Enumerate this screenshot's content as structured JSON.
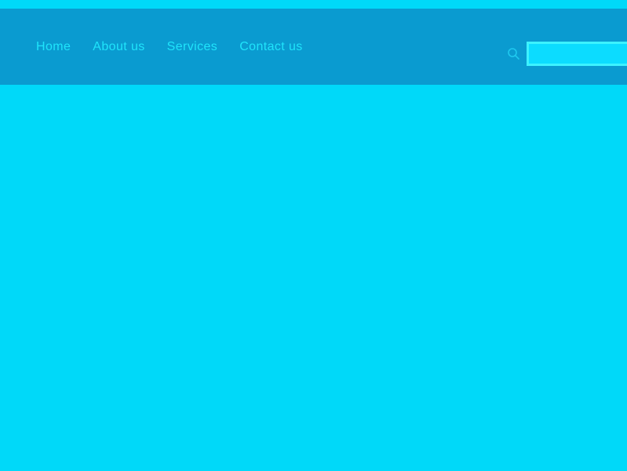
{
  "theme": {
    "page_background": "#00d9f9",
    "navbar_background": "#0a9bd0",
    "nav_link_color": "#1fe4fb",
    "search_border_color": "#3df2ff",
    "search_fill_color": "#0cdcff"
  },
  "navbar": {
    "items": [
      {
        "label": "Home"
      },
      {
        "label": "About us"
      },
      {
        "label": "Services"
      },
      {
        "label": "Contact us"
      }
    ],
    "search": {
      "icon": "search-icon",
      "value": "",
      "placeholder": ""
    }
  },
  "main": {
    "content": ""
  }
}
